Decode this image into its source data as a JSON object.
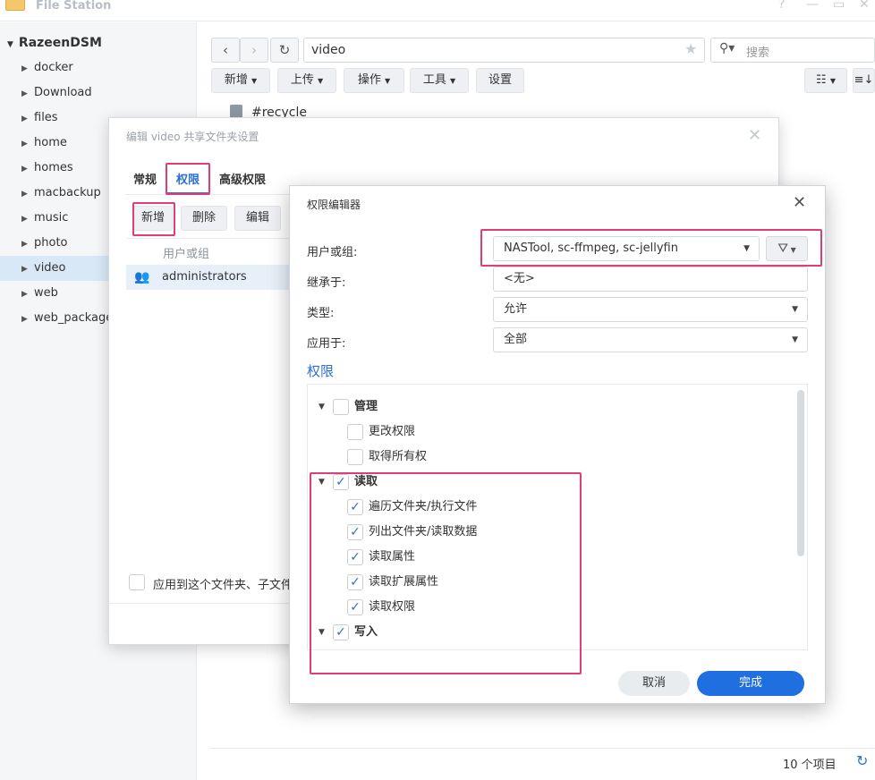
{
  "app": {
    "title": "File Station"
  },
  "window_controls": {
    "help": "?",
    "minimize": "—",
    "maximize": "▭",
    "close": "✕"
  },
  "sidebar": {
    "root": "RazeenDSM",
    "items": [
      {
        "label": "docker"
      },
      {
        "label": "Download"
      },
      {
        "label": "files"
      },
      {
        "label": "home"
      },
      {
        "label": "homes"
      },
      {
        "label": "macbackup"
      },
      {
        "label": "music"
      },
      {
        "label": "photo"
      },
      {
        "label": "video",
        "active": true
      },
      {
        "label": "web"
      },
      {
        "label": "web_packages"
      }
    ]
  },
  "toolbar": {
    "back": "‹",
    "forward": "›",
    "refresh": "↻",
    "path": "video",
    "search_placeholder": "搜索",
    "buttons": {
      "new": "新增",
      "upload": "上传",
      "action": "操作",
      "tools": "工具",
      "settings": "设置"
    },
    "view_list": "☷",
    "view_sort": "≡↓"
  },
  "files": [
    {
      "name": "#recycle"
    }
  ],
  "statusbar": {
    "count": "10 个项目"
  },
  "dialog1": {
    "title": "编辑 video 共享文件夹设置",
    "tabs": {
      "general": "常规",
      "permissions": "权限",
      "advanced": "高级权限"
    },
    "buttons": {
      "add": "新增",
      "delete": "删除",
      "edit": "编辑"
    },
    "column_header": "用户或组",
    "rows": [
      {
        "name": "administrators"
      }
    ],
    "apply_label": "应用到这个文件夹、子文件"
  },
  "dialog2": {
    "title": "权限编辑器",
    "user_group_label": "用户或组:",
    "user_group_value": "NASTool, sc-ffmpeg, sc-jellyfin",
    "inherit_label": "继承于:",
    "inherit_value": "<无>",
    "type_label": "类型:",
    "type_value": "允许",
    "apply_label": "应用于:",
    "apply_value": "全部",
    "perm_heading": "权限",
    "groups": {
      "admin": {
        "label": "管理",
        "checked": false,
        "children": [
          {
            "label": "更改权限",
            "checked": false
          },
          {
            "label": "取得所有权",
            "checked": false
          }
        ]
      },
      "read": {
        "label": "读取",
        "checked": true,
        "children": [
          {
            "label": "遍历文件夹/执行文件",
            "checked": true
          },
          {
            "label": "列出文件夹/读取数据",
            "checked": true
          },
          {
            "label": "读取属性",
            "checked": true
          },
          {
            "label": "读取扩展属性",
            "checked": true
          },
          {
            "label": "读取权限",
            "checked": true
          }
        ]
      },
      "write": {
        "label": "写入",
        "checked": true
      }
    },
    "cancel": "取消",
    "done": "完成"
  },
  "colors": {
    "accent": "#2a6fd6",
    "highlight": "#e23c7b",
    "primary_button": "#1f6fe0"
  }
}
